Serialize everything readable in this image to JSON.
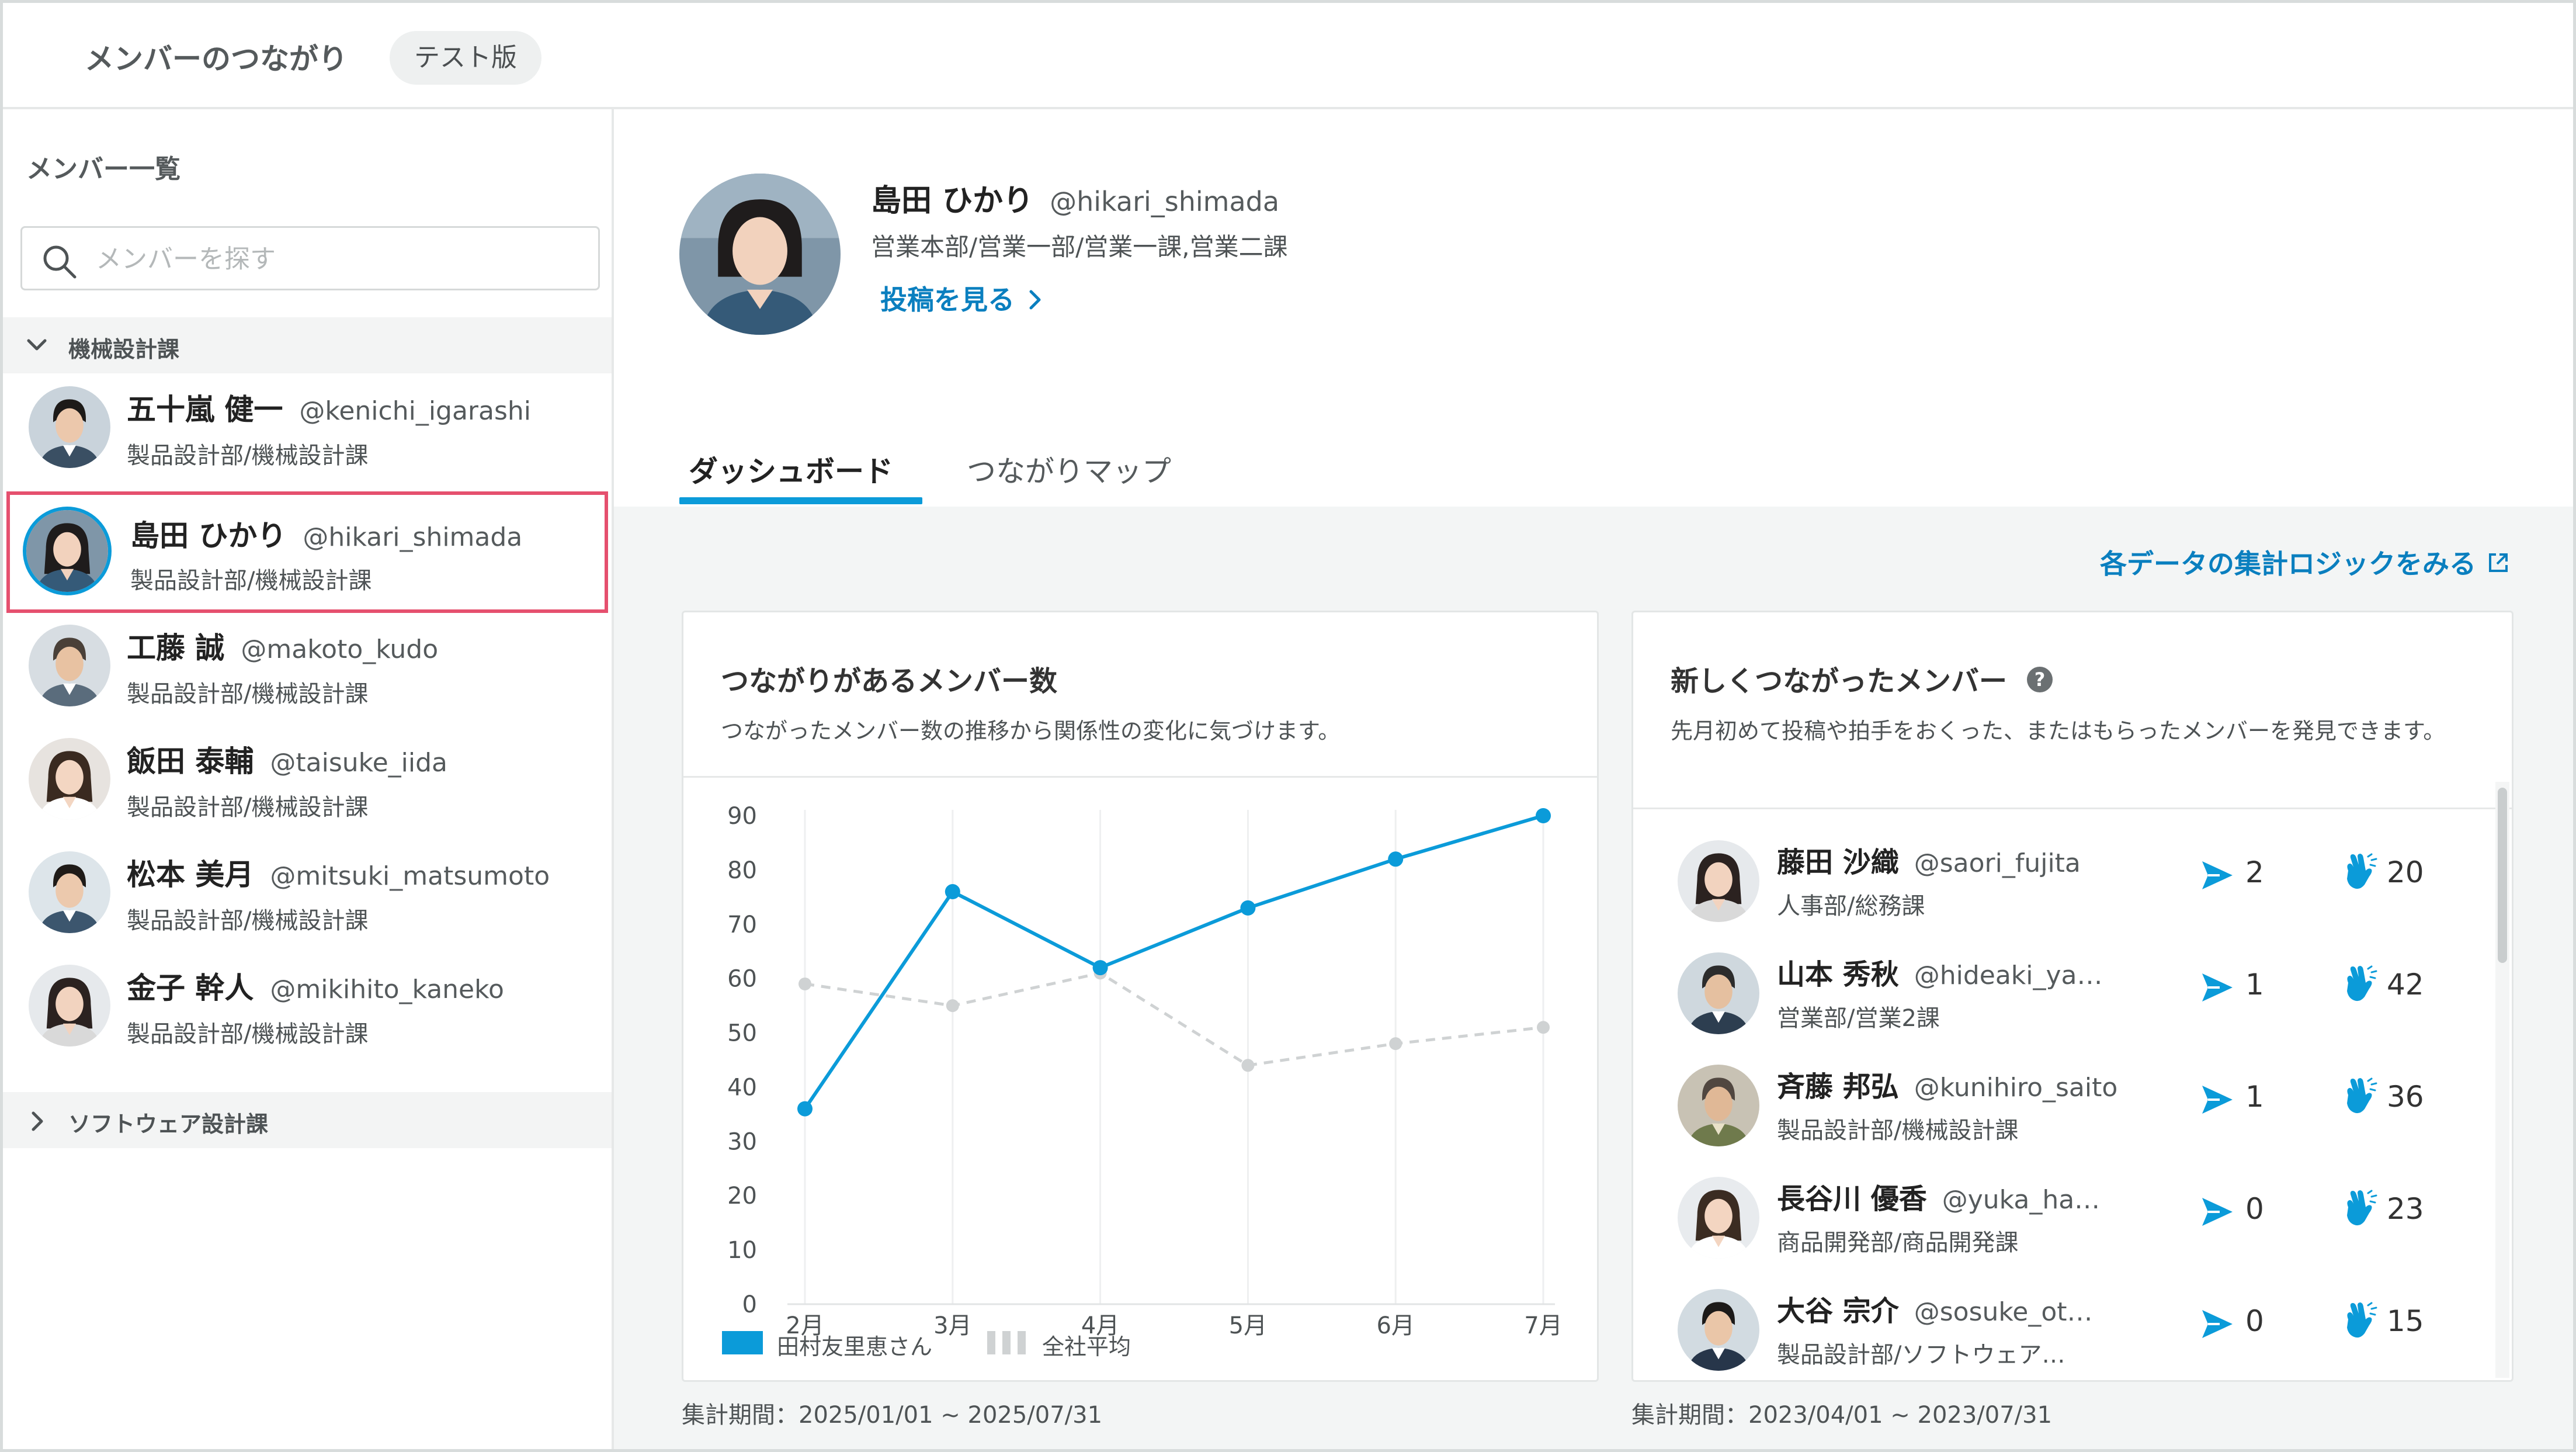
{
  "header": {
    "title": "メンバーのつながり",
    "badge": "テスト版"
  },
  "sidebar": {
    "heading": "メンバー一覧",
    "search_placeholder": "メンバーを探す",
    "groups": [
      {
        "label": "機械設計課",
        "expanded": true,
        "members": [
          {
            "name": "五十嵐 健一",
            "handle": "@kenichi_igarashi",
            "dept": "製品設計部/機械設計課",
            "selected": false
          },
          {
            "name": "島田 ひかり",
            "handle": "@hikari_shimada",
            "dept": "製品設計部/機械設計課",
            "selected": true
          },
          {
            "name": "工藤 誠",
            "handle": "@makoto_kudo",
            "dept": "製品設計部/機械設計課",
            "selected": false
          },
          {
            "name": "飯田 泰輔",
            "handle": "@taisuke_iida",
            "dept": "製品設計部/機械設計課",
            "selected": false
          },
          {
            "name": "松本 美月",
            "handle": "@mitsuki_matsumoto",
            "dept": "製品設計部/機械設計課",
            "selected": false
          },
          {
            "name": "金子 幹人",
            "handle": "@mikihito_kaneko",
            "dept": "製品設計部/機械設計課",
            "selected": false
          }
        ]
      },
      {
        "label": "ソフトウェア設計課",
        "expanded": false
      }
    ]
  },
  "profile": {
    "name": "島田 ひかり",
    "handle": "@hikari_shimada",
    "dept": "営業本部/営業一部/営業一課,営業二課",
    "posts_link": "投稿を見る"
  },
  "tabs": [
    {
      "label": "ダッシュボード",
      "active": true
    },
    {
      "label": "つながりマップ",
      "active": false
    }
  ],
  "logic_link": "各データの集計ロジックをみる",
  "connections_card": {
    "title": "つながりがあるメンバー数",
    "description": "つながったメンバー数の推移から関係性の変化に気づけます。",
    "period": "集計期間：2025/01/01 ~ 2025/07/31"
  },
  "new_members_card": {
    "title": "新しくつながったメンバー",
    "description": "先月初めて投稿や拍手をおくった、またはもらったメンバーを発見できます。",
    "period": "集計期間：2023/04/01 ~ 2023/07/31",
    "members": [
      {
        "name": "藤田 沙織",
        "handle": "@saori_fujita",
        "dept": "人事部/総務課",
        "sent": "2",
        "claps": "20"
      },
      {
        "name": "山本 秀秋",
        "handle": "@hideaki_ya…",
        "dept": "営業部/営業2課",
        "sent": "1",
        "claps": "42"
      },
      {
        "name": "斉藤 邦弘",
        "handle": "@kunihiro_saito",
        "dept": "製品設計部/機械設計課",
        "sent": "1",
        "claps": "36"
      },
      {
        "name": "長谷川 優香",
        "handle": "@yuka_ha…",
        "dept": "商品開発部/商品開発課",
        "sent": "0",
        "claps": "23"
      },
      {
        "name": "大谷 宗介",
        "handle": "@sosuke_ot…",
        "dept": "製品設計部/ソフトウェア…",
        "sent": "0",
        "claps": "15"
      }
    ]
  },
  "colors": {
    "accent": "#0b9bd9",
    "link": "#0a7fbf",
    "selection_border": "#e5506e",
    "average_line": "#cfd2d3"
  },
  "icons": {
    "search": "search-icon",
    "sent": "paper-plane-icon",
    "claps": "clapping-hands-icon",
    "help": "help-circle-icon",
    "external": "external-link-icon"
  },
  "chart_data": {
    "type": "line",
    "categories": [
      "2月",
      "3月",
      "4月",
      "5月",
      "6月",
      "7月"
    ],
    "series": [
      {
        "name": "田村友里恵さん",
        "values": [
          36,
          76,
          62,
          73,
          82,
          90
        ],
        "color": "#0b9bd9",
        "style": "solid"
      },
      {
        "name": "全社平均",
        "values": [
          59,
          55,
          61,
          44,
          48,
          51
        ],
        "color": "#cfd2d3",
        "style": "dashed"
      }
    ],
    "yticks": [
      0,
      10,
      20,
      30,
      40,
      50,
      60,
      70,
      80,
      90
    ],
    "ylim": [
      0,
      90
    ],
    "grid": "vertical",
    "legend": "bottom-left"
  }
}
